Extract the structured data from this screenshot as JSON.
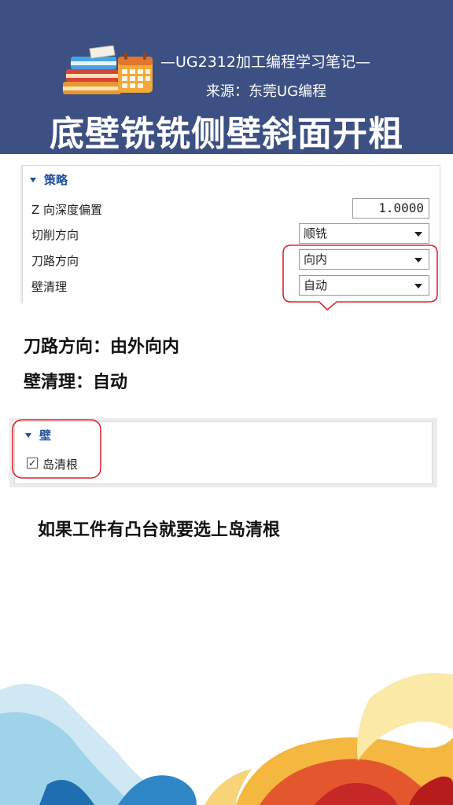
{
  "header": {
    "subtitle": "—UG2312加工编程学习笔记—",
    "source": "来源：东莞UG编程",
    "title": "底壁铣铣侧壁斜面开粗"
  },
  "strategy_panel": {
    "section_title": "策略",
    "rows": [
      {
        "label": "Z 向深度偏置",
        "value": "1.0000"
      },
      {
        "label": "切削方向",
        "value": "顺铣"
      },
      {
        "label": "刀路方向",
        "value": "向内"
      },
      {
        "label": "壁清理",
        "value": "自动"
      }
    ]
  },
  "notes": {
    "line1": "刀路方向：由外向内",
    "line2": "壁清理：自动",
    "line3": "如果工件有凸台就要选上岛清根"
  },
  "wall_panel": {
    "section_title": "壁",
    "checkbox_label": "岛清根",
    "checkbox_mark": "✓",
    "checked": true
  },
  "colors": {
    "header_bg": "#3d5083",
    "highlight": "#d8282f",
    "section_blue": "#1f4e9c"
  }
}
